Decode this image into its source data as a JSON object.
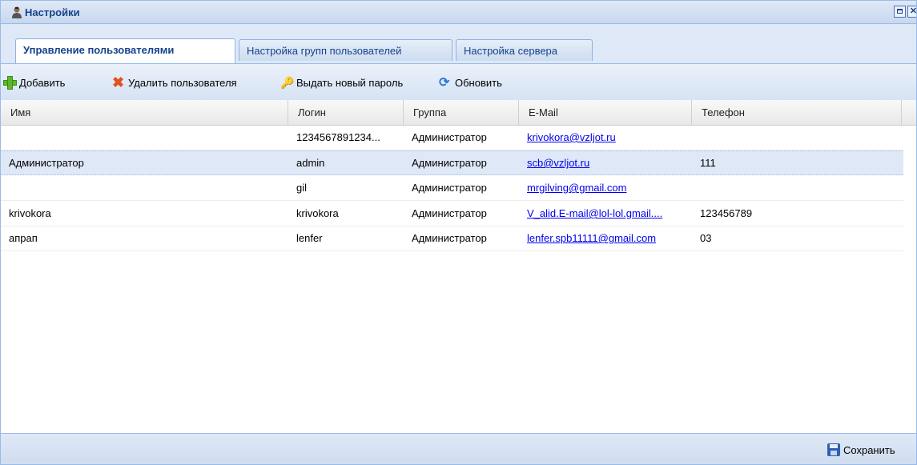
{
  "window": {
    "title": "Настройки",
    "icon": "user-icon"
  },
  "tabs": [
    {
      "label": "Управление пользователями",
      "active": true
    },
    {
      "label": "Настройка групп пользователей",
      "active": false
    },
    {
      "label": "Настройка сервера",
      "active": false
    }
  ],
  "toolbar": {
    "add_label": "Добавить",
    "delete_label": "Удалить пользователя",
    "new_password_label": "Выдать новый пароль",
    "refresh_label": "Обновить"
  },
  "grid": {
    "columns": [
      "Имя",
      "Логин",
      "Группа",
      "E-Mail",
      "Телефон"
    ],
    "rows": [
      {
        "name": "",
        "login": "1234567891234...",
        "group": "Администратор",
        "email": "krivokora@vzljot.ru",
        "phone": ""
      },
      {
        "name": "Администратор",
        "login": "admin",
        "group": "Администратор",
        "email": "scb@vzljot.ru",
        "phone": "111"
      },
      {
        "name": "",
        "login": "gil",
        "group": "Администратор",
        "email": "mrgilving@gmail.com",
        "phone": ""
      },
      {
        "name": "krivokora",
        "login": "krivokora",
        "group": "Администратор",
        "email": "V_alid.E-mail@lol-lol.gmail....",
        "phone": "123456789"
      },
      {
        "name": "апрап",
        "login": "lenfer",
        "group": "Администратор",
        "email": "lenfer.spb11111@gmail.com",
        "phone": "03"
      }
    ],
    "selected_row": 1
  },
  "footer": {
    "save_label": "Сохранить"
  },
  "colors": {
    "header_text": "#15428b",
    "panel_bg": "#dfe8f6",
    "border": "#99bbe8",
    "link": "#0000ee"
  }
}
